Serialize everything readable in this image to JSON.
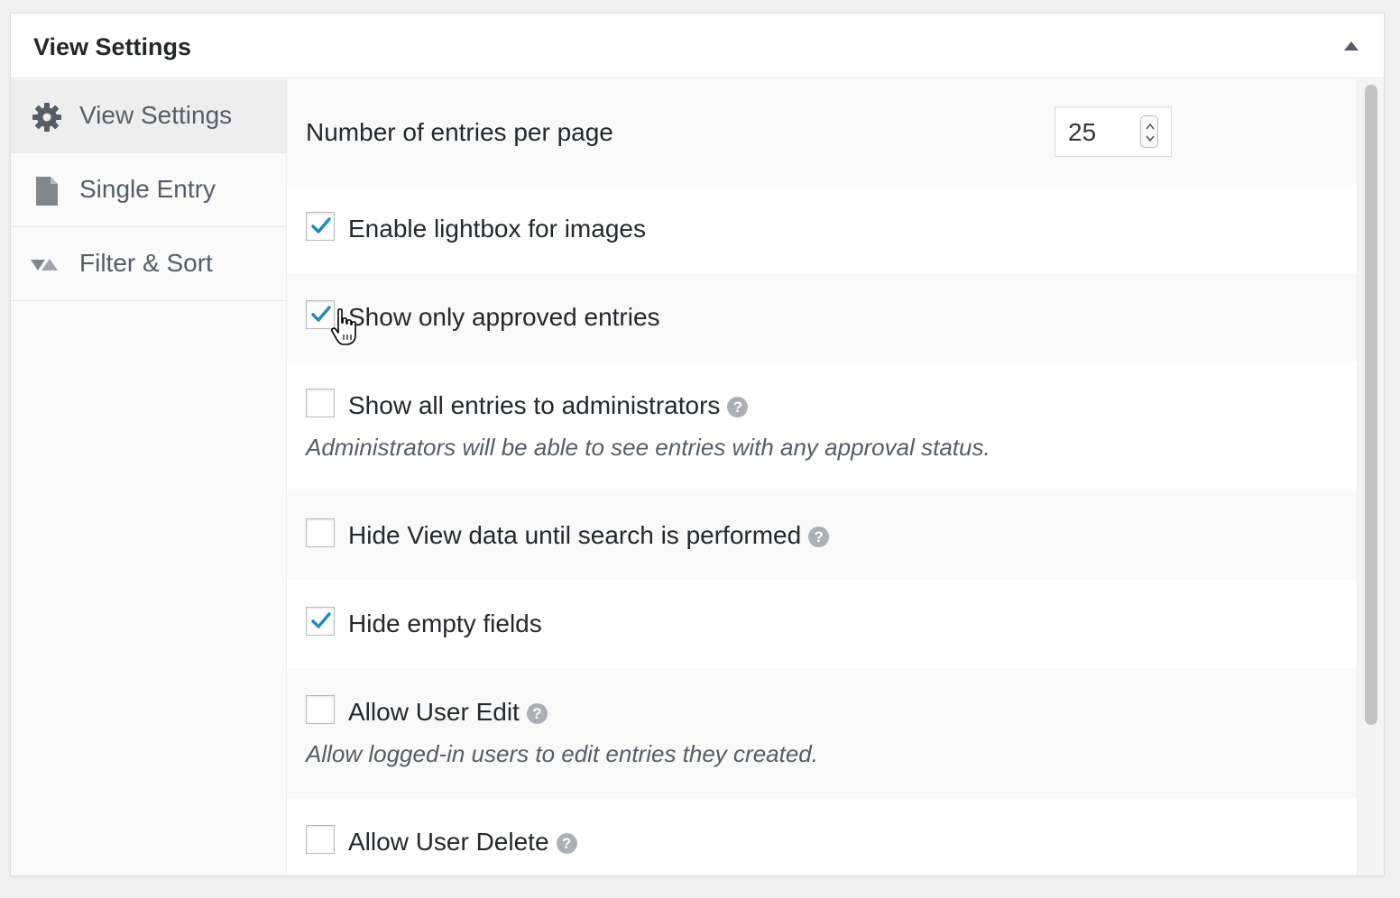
{
  "panel": {
    "title": "View Settings",
    "toggle_icon": "arrow-up-icon"
  },
  "tabs": [
    {
      "label": "View Settings",
      "icon": "gear-icon",
      "active": true
    },
    {
      "label": "Single Entry",
      "icon": "document-icon",
      "active": false
    },
    {
      "label": "Filter & Sort",
      "icon": "filter-sort-icon",
      "active": false
    }
  ],
  "settings": {
    "entries_per_page": {
      "label": "Number of entries per page",
      "value": "25"
    },
    "lightbox": {
      "label": "Enable lightbox for images",
      "checked": true
    },
    "approved_only": {
      "label": "Show only approved entries",
      "checked": true
    },
    "admin_show_all": {
      "label": "Show all entries to administrators",
      "checked": false,
      "description": "Administrators will be able to see entries with any approval status."
    },
    "hide_until_search": {
      "label": "Hide View data until search is performed",
      "checked": false
    },
    "hide_empty": {
      "label": "Hide empty fields",
      "checked": true
    },
    "user_edit": {
      "label": "Allow User Edit",
      "checked": false,
      "description": "Allow logged-in users to edit entries they created."
    },
    "user_delete": {
      "label": "Allow User Delete",
      "checked": false
    }
  },
  "colors": {
    "check": "#1e8cbe",
    "help_icon": "#aab0b5"
  }
}
